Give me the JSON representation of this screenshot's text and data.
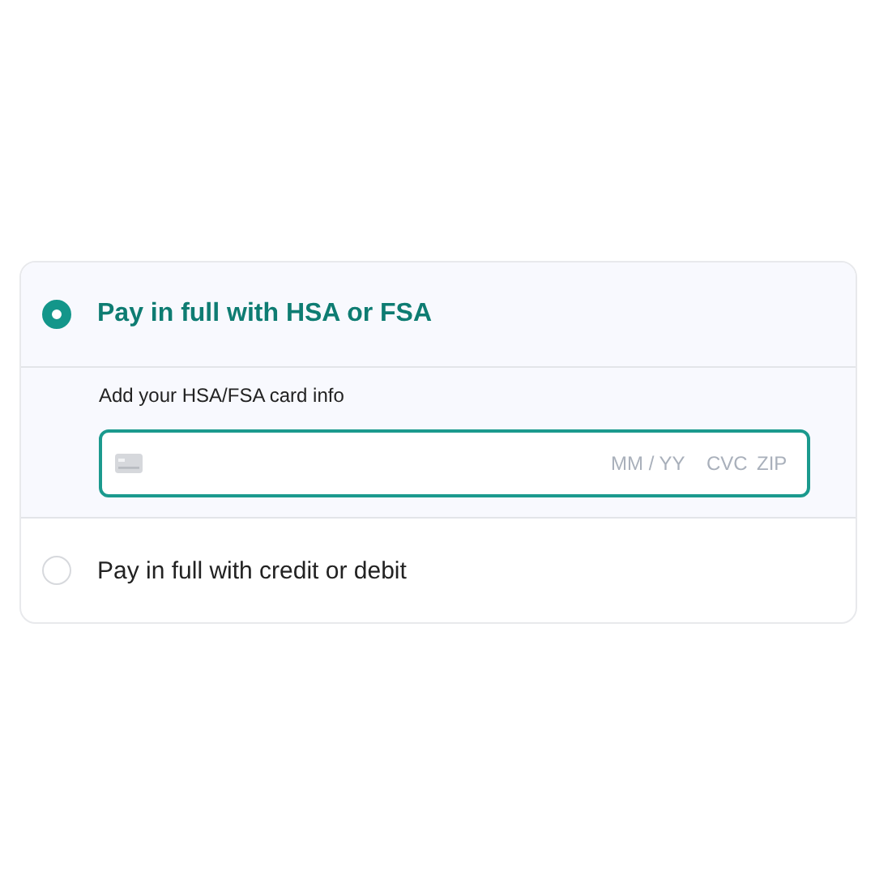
{
  "payment_options": [
    {
      "label": "Pay in full with HSA or FSA",
      "selected": true,
      "card_form": {
        "label": "Add your HSA/FSA card info",
        "fields": [
          {
            "placeholder": "MM / YY"
          },
          {
            "placeholder": "CVC"
          },
          {
            "placeholder": "ZIP"
          }
        ]
      }
    },
    {
      "label": "Pay in full with credit or debit",
      "selected": false
    }
  ]
}
